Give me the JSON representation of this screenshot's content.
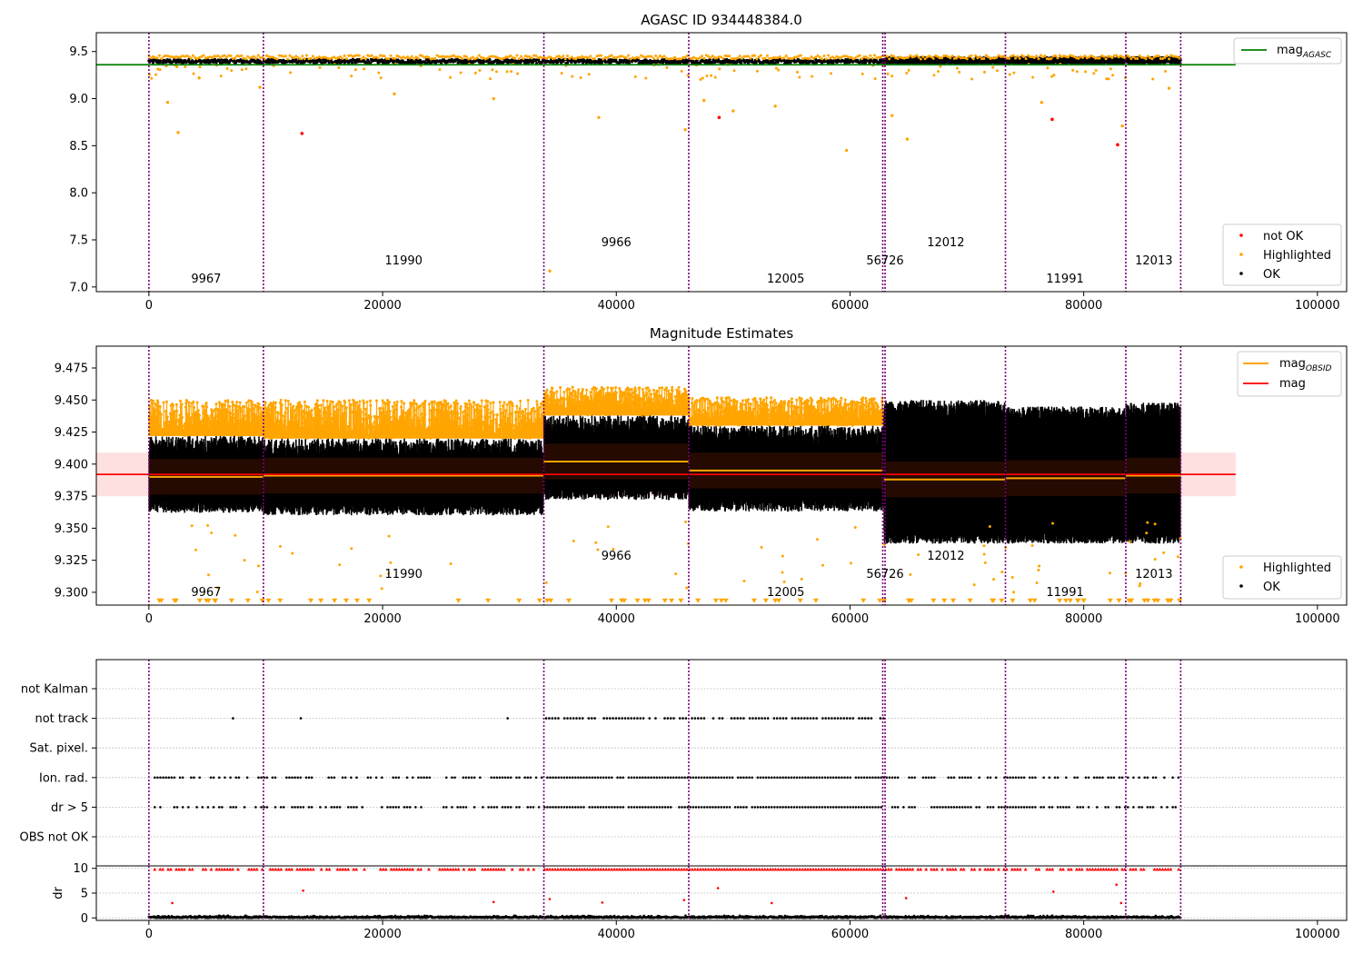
{
  "chart_data": [
    {
      "type": "scatter",
      "title": "AGASC ID 934448384.0",
      "xlim": [
        -4500,
        102500
      ],
      "ylim": [
        6.95,
        9.7
      ],
      "xticks": [
        "0",
        "20000",
        "40000",
        "60000",
        "80000",
        "100000"
      ],
      "yticks": [
        "7.0",
        "7.5",
        "8.0",
        "8.5",
        "9.0",
        "9.5"
      ],
      "ref_line": {
        "name": "mag_AGASC",
        "value": 9.36,
        "color": "#008000"
      },
      "ok_band": [
        9.37,
        9.43
      ],
      "highlighted_band": [
        9.32,
        9.46
      ],
      "legend_line": [
        "mag",
        "AGASC"
      ],
      "legend_points": [
        "not OK",
        "Highlighted",
        "OK"
      ],
      "not_ok_points": [
        [
          13100,
          8.63
        ],
        [
          48800,
          8.8
        ],
        [
          77300,
          8.78
        ],
        [
          82900,
          8.51
        ]
      ],
      "highlighted_outliers": [
        [
          1600,
          8.96
        ],
        [
          2500,
          8.64
        ],
        [
          4300,
          9.22
        ],
        [
          9500,
          9.12
        ],
        [
          21000,
          9.05
        ],
        [
          29500,
          9.0
        ],
        [
          34300,
          7.17
        ],
        [
          38500,
          8.8
        ],
        [
          45900,
          8.67
        ],
        [
          47500,
          8.98
        ],
        [
          50000,
          8.87
        ],
        [
          53600,
          8.92
        ],
        [
          59700,
          8.45
        ],
        [
          63600,
          8.82
        ],
        [
          64900,
          8.57
        ],
        [
          76400,
          8.96
        ],
        [
          83300,
          8.71
        ],
        [
          87300,
          9.11
        ]
      ]
    },
    {
      "type": "scatter",
      "title": "Magnitude Estimates",
      "xlim": [
        -4500,
        102500
      ],
      "ylim": [
        9.29,
        9.492
      ],
      "xticks": [
        "0",
        "20000",
        "40000",
        "60000",
        "80000",
        "100000"
      ],
      "yticks": [
        "9.300",
        "9.325",
        "9.350",
        "9.375",
        "9.400",
        "9.425",
        "9.450",
        "9.475"
      ],
      "mean_mag": 9.392,
      "mean_band": [
        9.375,
        9.409
      ],
      "legend_lines": [
        [
          "mag",
          "OBSID"
        ],
        [
          "mag",
          ""
        ]
      ],
      "legend_points": [
        "Highlighted",
        "OK"
      ],
      "segments": [
        {
          "x0": 0,
          "x1": 9800,
          "mag": 9.39,
          "ok": [
            9.362,
            9.422
          ],
          "hl": [
            9.354,
            9.45
          ]
        },
        {
          "x0": 9800,
          "x1": 33800,
          "mag": 9.391,
          "ok": [
            9.36,
            9.42
          ],
          "hl": [
            9.352,
            9.45
          ]
        },
        {
          "x0": 33800,
          "x1": 46200,
          "mag": 9.402,
          "ok": [
            9.372,
            9.438
          ],
          "hl": [
            9.364,
            9.46
          ]
        },
        {
          "x0": 46200,
          "x1": 62900,
          "mag": 9.395,
          "ok": [
            9.363,
            9.43
          ],
          "hl": [
            9.355,
            9.452
          ]
        },
        {
          "x0": 62900,
          "x1": 73300,
          "mag": 9.388,
          "ok": [
            9.338,
            9.45
          ],
          "hl": [
            9.338,
            9.45
          ]
        },
        {
          "x0": 73300,
          "x1": 83600,
          "mag": 9.389,
          "ok": [
            9.338,
            9.445
          ],
          "hl": [
            9.338,
            9.445
          ]
        },
        {
          "x0": 83600,
          "x1": 88300,
          "mag": 9.391,
          "ok": [
            9.338,
            9.448
          ],
          "hl": [
            9.338,
            9.448
          ]
        }
      ]
    },
    {
      "type": "scatter",
      "xlim": [
        -4500,
        102500
      ],
      "flag_categories": [
        "not Kalman",
        "not track",
        "Sat. pixel.",
        "Ion. rad.",
        "dr > 5",
        "OBS not OK"
      ],
      "flag_ranges": {
        "not track": [
          [
            34000,
            62900
          ]
        ],
        "Ion. rad.": [
          [
            500,
            88300
          ]
        ],
        "dr > 5": [
          [
            500,
            88300
          ]
        ]
      },
      "not_track_isolated": [
        7200,
        13000,
        30700
      ],
      "dr_ylabel": "dr",
      "dr_ylim": [
        -0.5,
        10.5
      ],
      "dr_yticks": [
        "0",
        "5",
        "10"
      ],
      "xticks": [
        "0",
        "20000",
        "40000",
        "60000",
        "80000",
        "100000"
      ]
    }
  ],
  "obsids": [
    {
      "label": "9967",
      "x": 4900,
      "level": 0
    },
    {
      "label": "11990",
      "x": 21800,
      "level": 1
    },
    {
      "label": "9966",
      "x": 40000,
      "level": 2
    },
    {
      "label": "12005",
      "x": 54500,
      "level": 0
    },
    {
      "label": "56726",
      "x": 63000,
      "level": 1
    },
    {
      "label": "12012",
      "x": 68200,
      "level": 2
    },
    {
      "label": "11991",
      "x": 78400,
      "level": 0
    },
    {
      "label": "12013",
      "x": 86000,
      "level": 1
    }
  ],
  "obs_boundaries": [
    0,
    9800,
    33800,
    46200,
    62800,
    63000,
    73300,
    83600,
    88300
  ]
}
